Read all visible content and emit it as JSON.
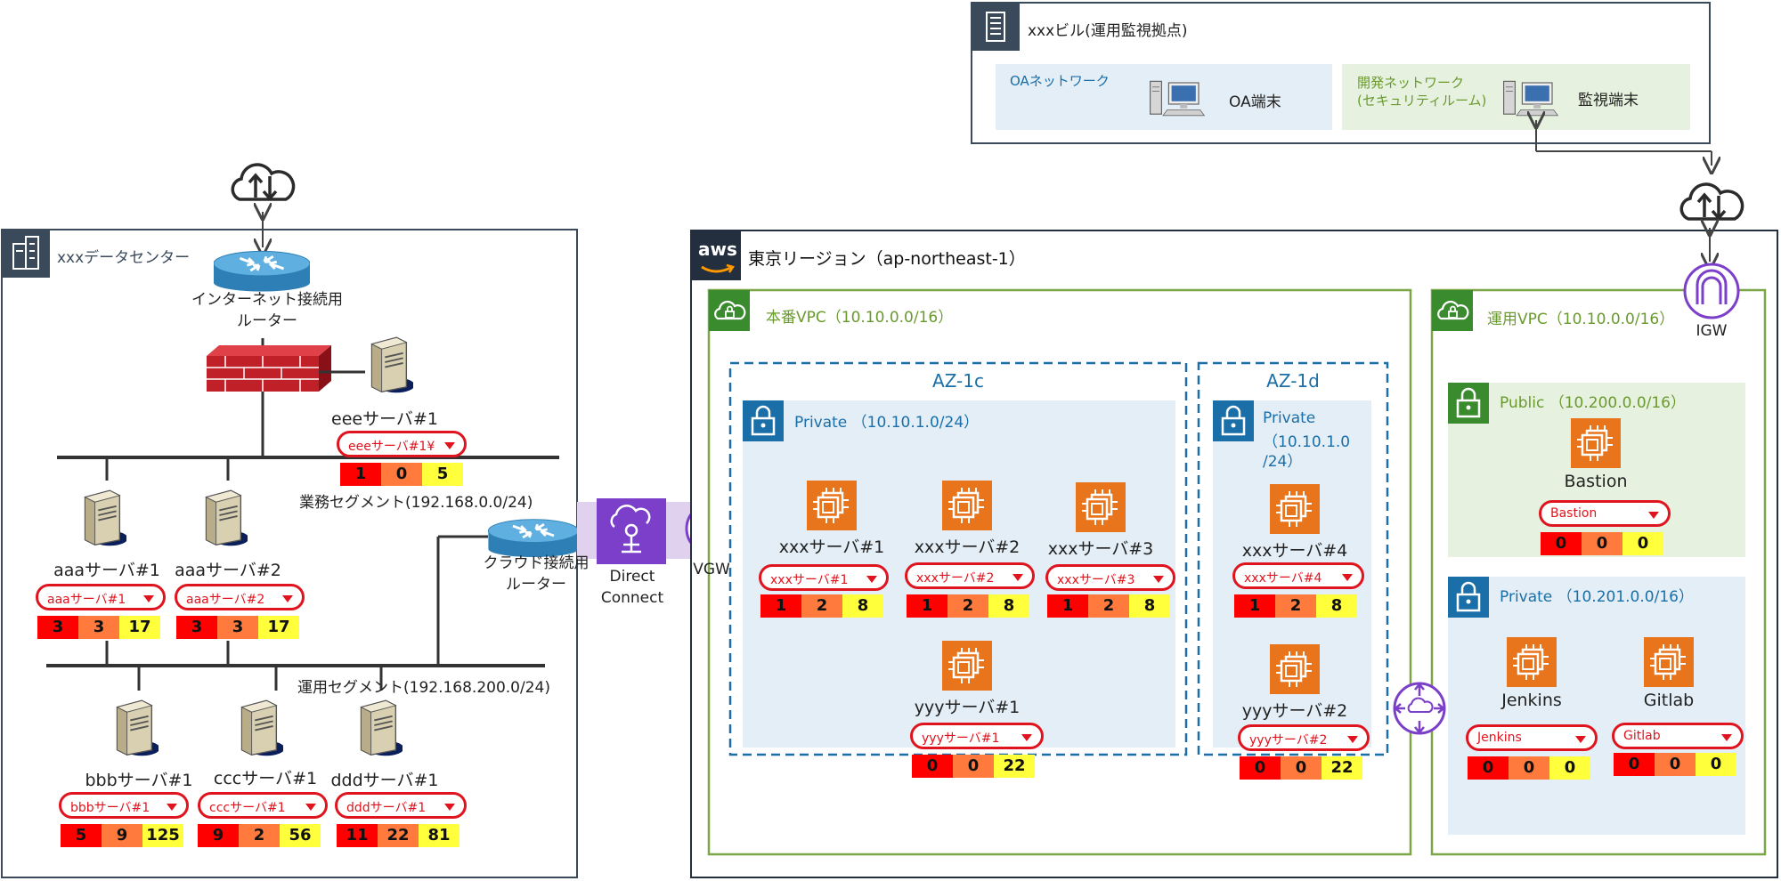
{
  "office": {
    "title": "xxxビル(運用監視拠点)",
    "oa_network": "OAネットワーク",
    "oa_terminal": "OA端末",
    "dev_network_line1": "開発ネットワーク",
    "dev_network_line2": "(セキュリティルーム)",
    "monitor_terminal": "監視端末"
  },
  "datacenter": {
    "title": "xxxデータセンター",
    "internet_router_line1": "インターネット接続用",
    "internet_router_line2": "ルーター",
    "cloud_router_line1": "クラウド接続用",
    "cloud_router_line2": "ルーター",
    "business_segment": "業務セグメント(192.168.0.0/24)",
    "ops_segment": "運用セグメント(192.168.200.0/24)",
    "servers": [
      {
        "name": "eeeサーバ#1",
        "dropdown": "eeeサーバ#1¥",
        "counts": [
          "1",
          "0",
          "5"
        ]
      },
      {
        "name": "aaaサーバ#1",
        "dropdown": "aaaサーバ#1",
        "counts": [
          "3",
          "3",
          "17"
        ]
      },
      {
        "name": "aaaサーバ#2",
        "dropdown": "aaaサーバ#2",
        "counts": [
          "3",
          "3",
          "17"
        ]
      },
      {
        "name": "bbbサーバ#1",
        "dropdown": "bbbサーバ#1",
        "counts": [
          "5",
          "9",
          "125"
        ]
      },
      {
        "name": "cccサーバ#1",
        "dropdown": "cccサーバ#1",
        "counts": [
          "9",
          "2",
          "56"
        ]
      },
      {
        "name": "dddサーバ#1",
        "dropdown": "dddサーバ#1",
        "counts": [
          "11",
          "22",
          "81"
        ]
      }
    ]
  },
  "connect": {
    "direct_connect_line1": "Direct",
    "direct_connect_line2": "Connect",
    "vgw": "VGW",
    "igw": "IGW"
  },
  "aws": {
    "logo": "aws",
    "region": "東京リージョン（ap-northeast-1）",
    "prod_vpc": "本番VPC（10.10.0.0/16）",
    "ops_vpc": "運用VPC（10.10.0.0/16）",
    "az1c": "AZ-1c",
    "az1d": "AZ-1d",
    "private_1c": "Private （10.10.1.0/24）",
    "private_1d_line1": "Private",
    "private_1d_line2": "（10.10.1.0",
    "private_1d_line3": "/24）",
    "public_ops": "Public （10.200.0.0/16）",
    "private_ops": "Private （10.201.0.0/16）",
    "instances": [
      {
        "name": "xxxサーバ#1",
        "dropdown": "xxxサーバ#1",
        "counts": [
          "1",
          "2",
          "8"
        ]
      },
      {
        "name": "xxxサーバ#2",
        "dropdown": "xxxサーバ#2",
        "counts": [
          "1",
          "2",
          "8"
        ]
      },
      {
        "name": "xxxサーバ#3",
        "dropdown": "xxxサーバ#3",
        "counts": [
          "1",
          "2",
          "8"
        ]
      },
      {
        "name": "xxxサーバ#4",
        "dropdown": "xxxサーバ#4",
        "counts": [
          "1",
          "2",
          "8"
        ]
      },
      {
        "name": "yyyサーバ#1",
        "dropdown": "yyyサーバ#1",
        "counts": [
          "0",
          "0",
          "22"
        ]
      },
      {
        "name": "yyyサーバ#2",
        "dropdown": "yyyサーバ#2",
        "counts": [
          "0",
          "0",
          "22"
        ]
      },
      {
        "name": "Bastion",
        "dropdown": "Bastion",
        "counts": [
          "0",
          "0",
          "0"
        ]
      },
      {
        "name": "Jenkins",
        "dropdown": "Jenkins",
        "counts": [
          "0",
          "0",
          "0"
        ]
      },
      {
        "name": "Gitlab",
        "dropdown": "Gitlab",
        "counts": [
          "0",
          "0",
          "0"
        ]
      }
    ]
  },
  "colors": {
    "alert_red": "#ff0000",
    "alert_orange": "#ff7a3c",
    "alert_yellow": "#ffff3c",
    "dropdown_border": "#e0141e",
    "vpc_green": "#7aa645",
    "private_blue": "#1a6fa8",
    "ec2_orange": "#e8741c",
    "connect_purple": "#7b3fc9"
  },
  "icons": [
    "building-icon",
    "office-icon",
    "server-icon",
    "pc-icon",
    "cloud-icon",
    "router-icon",
    "firewall-icon",
    "ec2-icon",
    "lock-icon",
    "vpc-cloud-icon",
    "direct-connect-icon",
    "vgw-icon",
    "igw-icon",
    "transit-icon",
    "aws-logo"
  ]
}
